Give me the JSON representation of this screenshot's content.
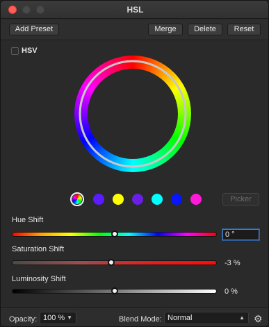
{
  "window": {
    "title": "HSL"
  },
  "toolbar": {
    "add_preset": "Add Preset",
    "merge": "Merge",
    "delete": "Delete",
    "reset": "Reset"
  },
  "hsv": {
    "label": "HSV",
    "checked": false
  },
  "swatches": [
    {
      "name": "master",
      "color": "rainbow",
      "selected": true
    },
    {
      "name": "violet",
      "color": "#5b1cff",
      "selected": false
    },
    {
      "name": "yellow",
      "color": "#ffff00",
      "selected": false
    },
    {
      "name": "purple",
      "color": "#6a1fe6",
      "selected": false
    },
    {
      "name": "cyan",
      "color": "#00ffff",
      "selected": false
    },
    {
      "name": "blue",
      "color": "#0a14ff",
      "selected": false
    },
    {
      "name": "magenta",
      "color": "#ff1ad9",
      "selected": false
    }
  ],
  "picker_label": "Picker",
  "hue": {
    "label": "Hue Shift",
    "value": "0 °",
    "level": 0.5
  },
  "saturation": {
    "label": "Saturation Shift",
    "value": "-3 %",
    "level": 0.485
  },
  "luminosity": {
    "label": "Luminosity Shift",
    "value": "0 %",
    "level": 0.5
  },
  "bottom": {
    "opacity_label": "Opacity:",
    "opacity_value": "100 %",
    "blend_label": "Blend Mode:",
    "blend_value": "Normal"
  },
  "icons": {
    "settings": "gear-icon",
    "dropdown": "chevron-down-icon"
  }
}
